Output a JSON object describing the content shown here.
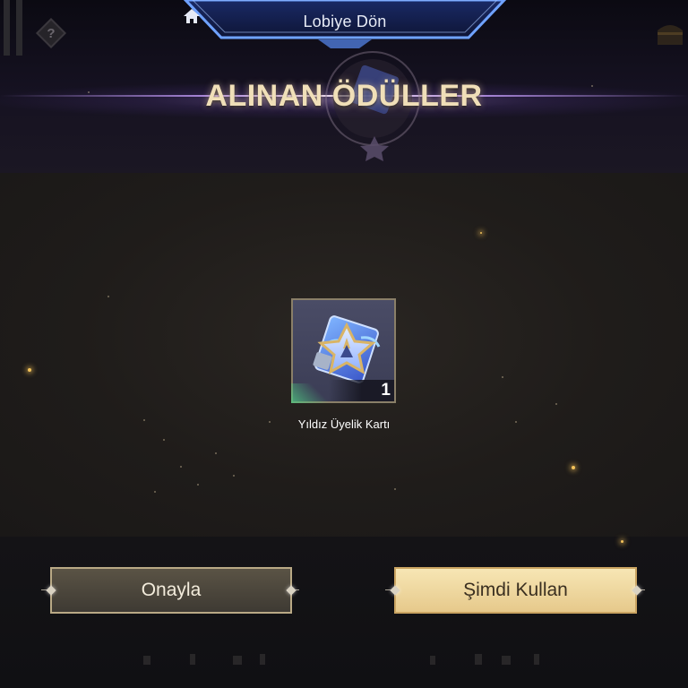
{
  "header": {
    "back_to_lobby_label": "Lobiye Dön",
    "title": "ALINAN ÖDÜLLER"
  },
  "reward": {
    "name": "Yıldız Üyelik Kartı",
    "quantity": "1"
  },
  "buttons": {
    "confirm_label": "Onayla",
    "use_now_label": "Şimdi Kullan"
  },
  "icons": [
    "home-icon",
    "help-icon",
    "treasure-chest-icon",
    "emblem-icon",
    "star-membership-card-icon"
  ],
  "colors": {
    "title": "#f0dfb8",
    "banner_border": "#6fa2ff",
    "confirm_button": "#4a4540",
    "use_button": "#f1dba2",
    "background": "#1d1a19"
  }
}
